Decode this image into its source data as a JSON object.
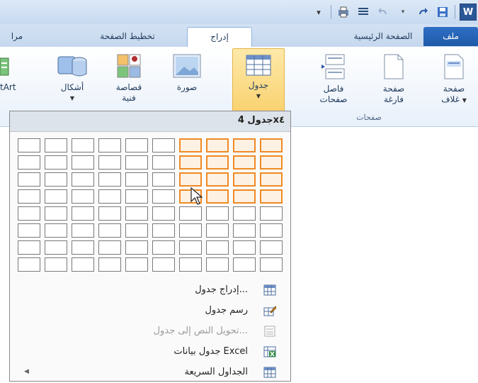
{
  "tabs": {
    "file": "ملف",
    "home": "الصفحة الرئيسية",
    "insert": "إدراج",
    "page_layout": "تخطيط الصفحة",
    "review": "مرا"
  },
  "qat": {
    "logo_letter": "W"
  },
  "ribbon": {
    "cover_page": [
      "صفحة",
      "غلاف"
    ],
    "blank_page": [
      "صفحة",
      "فارغة"
    ],
    "page_break": [
      "فاصل",
      "صفحات"
    ],
    "pages_group_label": "صفحات",
    "table": "جدول",
    "picture": "صورة",
    "clip_art": [
      "قصاصة",
      "فنية"
    ],
    "shapes": "أشكال",
    "smartart": "tArt"
  },
  "table_dropdown": {
    "header": "جدول 4x٤",
    "grid": {
      "columns": 10,
      "rows": 8,
      "selected_columns": 4,
      "selected_rows": 4
    },
    "menu": [
      {
        "label": "إدراج جدول...",
        "icon": "insert-table-icon",
        "enabled": true
      },
      {
        "label": "رسم جدول",
        "icon": "draw-table-icon",
        "enabled": true
      },
      {
        "label": "تحويل النص إلى جدول...",
        "icon": "convert-text-icon",
        "enabled": false
      },
      {
        "label": "جدول بيانات Excel",
        "icon": "excel-icon",
        "enabled": true
      },
      {
        "label": "الجداول السريعة",
        "icon": "quick-tables-icon",
        "enabled": true
      }
    ]
  },
  "colors": {
    "accent": "#2b5797",
    "selection": "#f08a24",
    "table_button_bg": "#f9d271"
  }
}
